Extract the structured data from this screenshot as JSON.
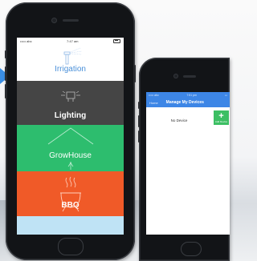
{
  "phone1": {
    "status": {
      "carrier": "••••• abc",
      "time": "7:47 am"
    },
    "tiles": [
      {
        "label": "Irrigation",
        "icon": "sprinkler-icon",
        "color": "#ffffff"
      },
      {
        "label": "Lighting",
        "icon": "light-icon",
        "color": "#454545"
      },
      {
        "label": "GrowHouse",
        "icon": "greenhouse-icon",
        "color": "#2dbd6e"
      },
      {
        "label": "BBQ",
        "icon": "bbq-icon",
        "color": "#f05a28"
      },
      {
        "label": "",
        "icon": "",
        "color": "#bfe3f5"
      }
    ]
  },
  "phone2": {
    "status": {
      "carrier": "••••• abc",
      "time": "7:51 pm"
    },
    "nav": {
      "back": "Home",
      "title": "Manage My Devices"
    },
    "empty_text": "No Device",
    "fab": {
      "symbol": "+",
      "label": "Add Device"
    }
  },
  "colors": {
    "accent": "#3d86e6",
    "arrow": "#3b8ee3",
    "fab": "#3cbf63"
  }
}
